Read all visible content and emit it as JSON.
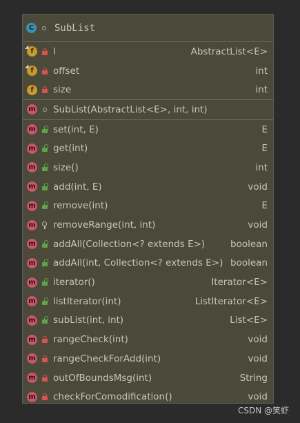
{
  "class": {
    "name": "SubList",
    "icon": "C"
  },
  "fields": [
    {
      "name": "l",
      "type": "AbstractList<E>",
      "pinned": true
    },
    {
      "name": "offset",
      "type": "int",
      "pinned": true
    },
    {
      "name": "size",
      "type": "int",
      "pinned": false
    }
  ],
  "constructor": {
    "name": "SubList(AbstractList<E>, int, int)",
    "type": ""
  },
  "methods": [
    {
      "name": "set(int, E)",
      "type": "E",
      "access": "public"
    },
    {
      "name": "get(int)",
      "type": "E",
      "access": "public"
    },
    {
      "name": "size()",
      "type": "int",
      "access": "public"
    },
    {
      "name": "add(int, E)",
      "type": "void",
      "access": "public"
    },
    {
      "name": "remove(int)",
      "type": "E",
      "access": "public"
    },
    {
      "name": "removeRange(int, int)",
      "type": "void",
      "access": "protected"
    },
    {
      "name": "addAll(Collection<? extends E>)",
      "type": "boolean",
      "access": "public"
    },
    {
      "name": "addAll(int, Collection<? extends E>)",
      "type": "boolean",
      "access": "public"
    },
    {
      "name": "iterator()",
      "type": "Iterator<E>",
      "access": "public"
    },
    {
      "name": "listIterator(int)",
      "type": "ListIterator<E>",
      "access": "public"
    },
    {
      "name": "subList(int, int)",
      "type": "List<E>",
      "access": "public"
    },
    {
      "name": "rangeCheck(int)",
      "type": "void",
      "access": "private"
    },
    {
      "name": "rangeCheckForAdd(int)",
      "type": "void",
      "access": "private"
    },
    {
      "name": "outOfBoundsMsg(int)",
      "type": "String",
      "access": "private"
    },
    {
      "name": "checkForComodification()",
      "type": "void",
      "access": "private"
    }
  ],
  "watermark": "CSDN @笑虾"
}
